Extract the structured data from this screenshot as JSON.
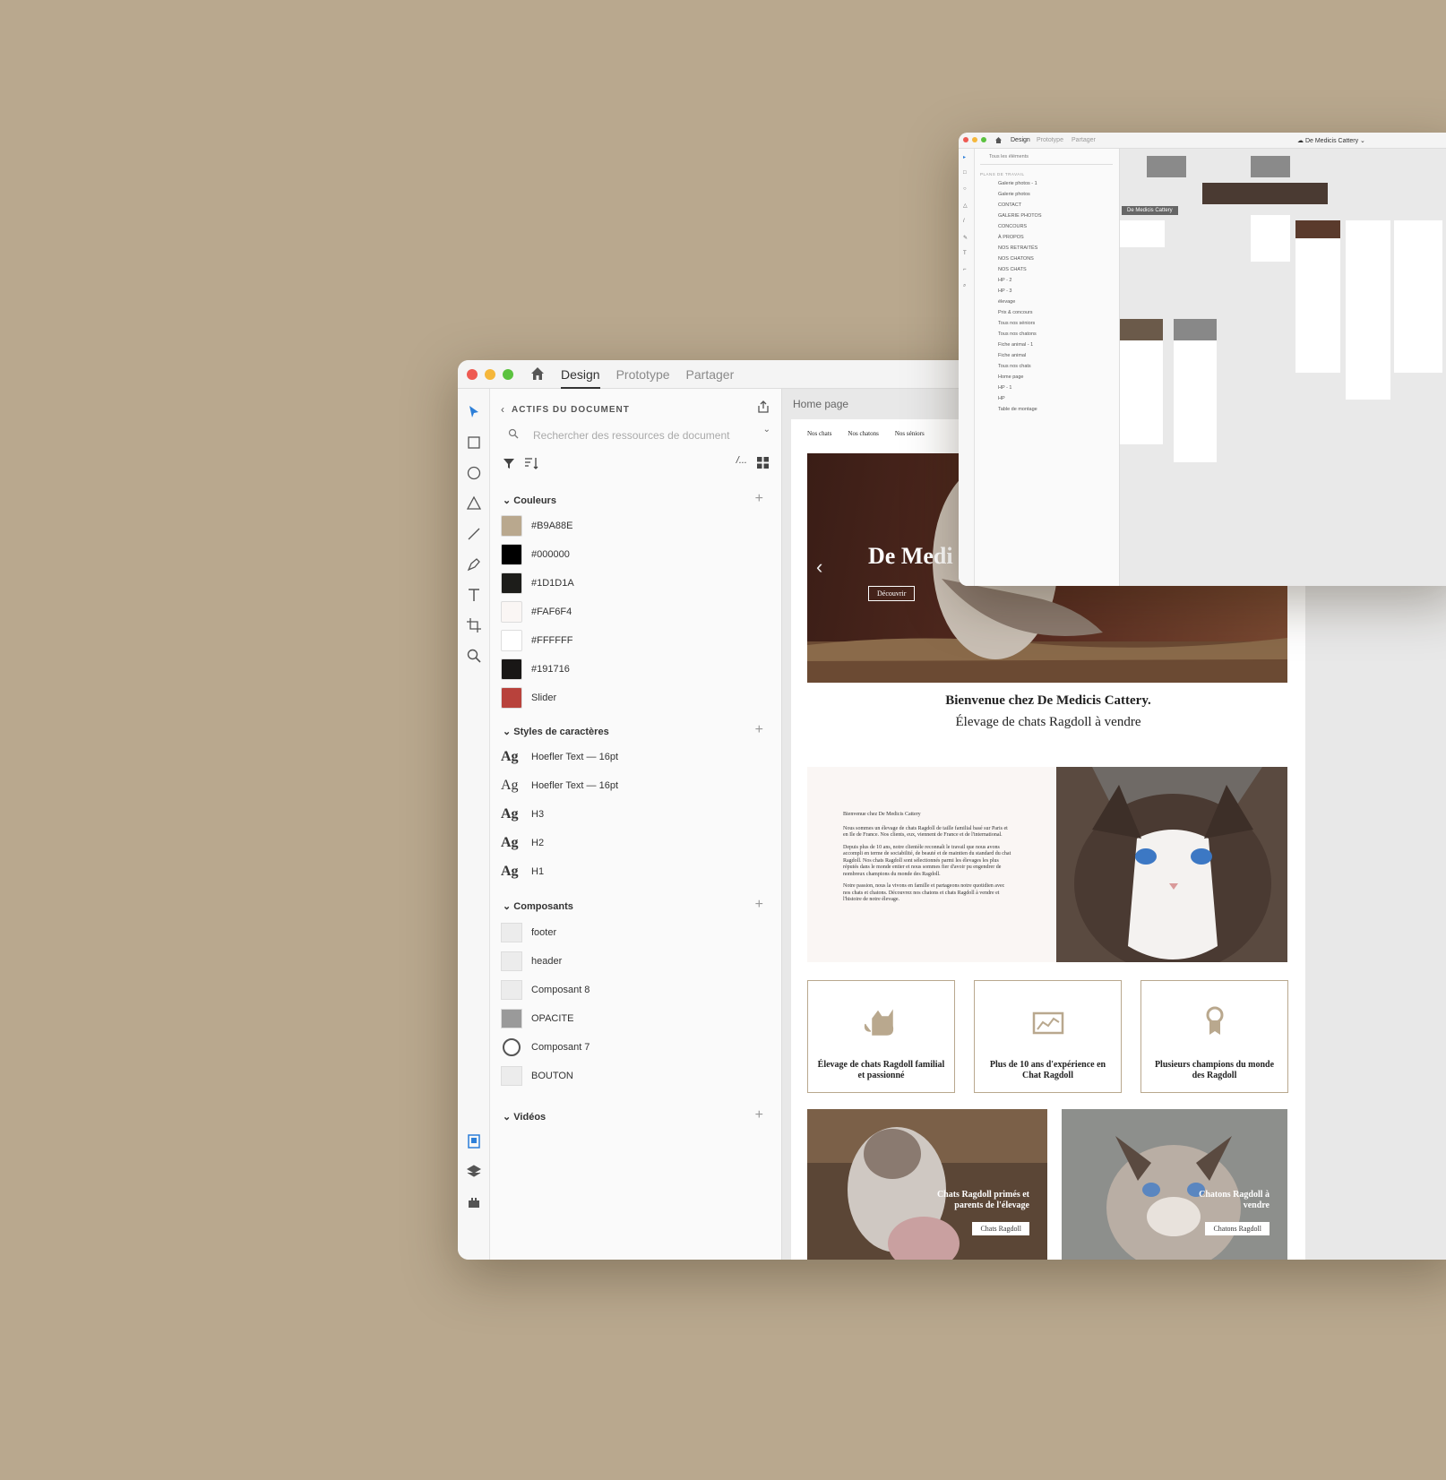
{
  "main_window": {
    "tabs": [
      "Design",
      "Prototype",
      "Partager"
    ],
    "panel": {
      "title": "ACTIFS DU DOCUMENT",
      "search_placeholder": "Rechercher des ressources de document",
      "colors_title": "Couleurs",
      "colors": [
        {
          "label": "#B9A88E",
          "hex": "#B9A88E"
        },
        {
          "label": "#000000",
          "hex": "#000000"
        },
        {
          "label": "#1D1D1A",
          "hex": "#1D1D1A"
        },
        {
          "label": "#FAF6F4",
          "hex": "#FAF6F4"
        },
        {
          "label": "#FFFFFF",
          "hex": "#FFFFFF"
        },
        {
          "label": "#191716",
          "hex": "#191716"
        },
        {
          "label": "Slider",
          "hex": "#B8423C"
        }
      ],
      "styles_title": "Styles de caractères",
      "styles": [
        "Hoefler Text — 16pt",
        "Hoefler Text — 16pt",
        "H3",
        "H2",
        "H1"
      ],
      "ag": "Ag",
      "components_title": "Composants",
      "components": [
        "footer",
        "header",
        "Composant 8",
        "OPACITE",
        "Composant 7",
        "BOUTON"
      ],
      "videos_title": "Vidéos"
    },
    "artboard": {
      "name": "Home page",
      "nav": [
        "Nos chats",
        "Nos chatons",
        "Nos séniors"
      ],
      "hero_title": "De Medi",
      "hero_button": "Découvrir",
      "welcome_title": "Bienvenue chez De Medicis Cattery.",
      "welcome_sub": "Élevage de chats Ragdoll à vendre",
      "intro_heading": "Bienvenue chez De Medicis Cattery",
      "intro_p1": "Nous sommes un élevage de chats Ragdoll de taille familial basé sur Paris et en Ile de France. Nos clients, eux, viennent de France et de l'international.",
      "intro_p2": "Depuis plus de 10 ans, notre clientèle reconnaît le travail que nous avons accompli en terme de sociabilité, de beauté et de maintien du standard du chat Ragdoll. Nos chats Ragdoll sont sélectionnés parmi les élevages les plus réputés dans le monde entier et nous sommes fier d'avoir pu engendrer de nombreux champions du monde des Ragdoll.",
      "intro_p3": "Notre passion, nous la vivons en famille et partageons notre quotidien avec nos chats et chatons. Découvrez nos chatons et chats Ragdoll à vendre et l'histoire de notre élevage.",
      "features": [
        "Élevage de chats Ragdoll familial et passionné",
        "Plus de 10 ans d'expérience en Chat Ragdoll",
        "Plusieurs champions du monde des Ragdoll"
      ],
      "cards": [
        {
          "text": "Chats Ragdoll primés et parents de l'élevage",
          "button": "Chats Ragdoll"
        },
        {
          "text": "Chatons Ragdoll à vendre",
          "button": "Chatons Ragdoll"
        }
      ]
    }
  },
  "second_window": {
    "tabs": [
      "Design",
      "Prototype",
      "Partager"
    ],
    "doc_name": "De Medicis Cattery",
    "search_placeholder": "Tous les éléments",
    "layers_title": "PLANS DE TRAVAIL",
    "layers": [
      "Galerie photos - 1",
      "Galerie photos",
      "CONTACT",
      "GALERIE PHOTOS",
      "CONCOURS",
      "À PROPOS",
      "NOS RETRAITÉS",
      "NOS CHATONS",
      "NOS CHATS",
      "HP - 2",
      "HP - 3",
      "élevage",
      "Prix & concours",
      "Tous nos séniors",
      "Tous nos chatons",
      "Fiche animal - 1",
      "Fiche animal",
      "Tous nos chats",
      "Home page",
      "HP - 1",
      "HP",
      "Table de montage"
    ],
    "canvas_label": "De Medicis Cattery"
  }
}
